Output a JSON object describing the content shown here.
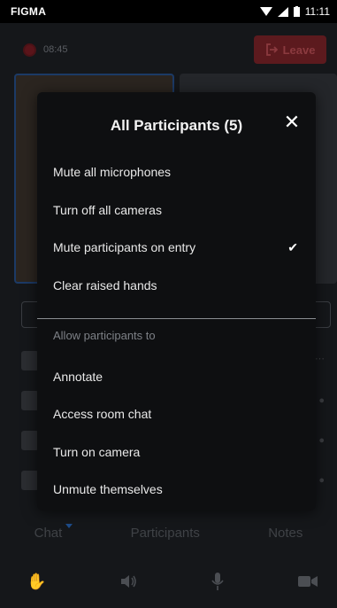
{
  "statusbar": {
    "carrier": "FIGMA",
    "time": "11:11"
  },
  "app": {
    "timer": "08:45",
    "leave_label": "Leave",
    "tabs": [
      {
        "label": "Chat",
        "active": true
      },
      {
        "label": "Participants",
        "active": false
      },
      {
        "label": "Notes",
        "active": false
      }
    ],
    "controls": [
      "hand-icon",
      "speaker-icon",
      "microphone-icon",
      "camera-icon"
    ]
  },
  "modal": {
    "title": "All Participants (5)",
    "close_icon": "close-icon",
    "items": [
      {
        "label": "Mute all microphones",
        "checked": false
      },
      {
        "label": "Turn off all cameras",
        "checked": false
      },
      {
        "label": "Mute participants on entry",
        "checked": true
      },
      {
        "label": "Clear raised hands",
        "checked": false
      }
    ],
    "section_label": "Allow participants to",
    "allow_items": [
      {
        "label": "Annotate"
      },
      {
        "label": "Access room chat"
      },
      {
        "label": "Turn on camera"
      },
      {
        "label": "Unmute themselves"
      }
    ]
  },
  "colors": {
    "accent": "#1e4c8a",
    "leave": "#5c1a1e",
    "modal_bg": "#0e0f11"
  }
}
